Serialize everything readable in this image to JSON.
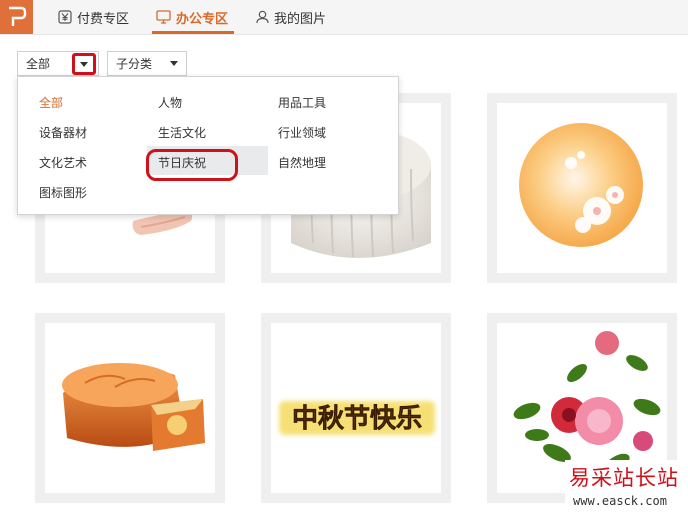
{
  "topbar": {
    "tabs": [
      {
        "label": "付费专区",
        "icon": "yen-icon"
      },
      {
        "label": "办公专区",
        "icon": "monitor-icon",
        "active": true
      },
      {
        "label": "我的图片",
        "icon": "user-icon"
      }
    ]
  },
  "filters": {
    "category": "全部",
    "subcategory": "子分类"
  },
  "dropdown": {
    "items": [
      "全部",
      "人物",
      "用品工具",
      "设备器材",
      "生活文化",
      "行业领域",
      "文化艺术",
      "节日庆祝",
      "自然地理",
      "图标图形"
    ],
    "selected": "全部",
    "highlighted": "节日庆祝"
  },
  "gallery": {
    "items": [
      {
        "name": "hand-image"
      },
      {
        "name": "white-mooncake-image"
      },
      {
        "name": "orange-flower-orb-image"
      },
      {
        "name": "mooncake-image"
      },
      {
        "name": "mid-autumn-text-image",
        "text": "中秋节快乐"
      },
      {
        "name": "peony-image"
      }
    ]
  },
  "watermark": {
    "title": "易采站长站",
    "url": "www.easck.com"
  },
  "colors": {
    "accent": "#d96a2a",
    "annotation": "#d0101a"
  }
}
